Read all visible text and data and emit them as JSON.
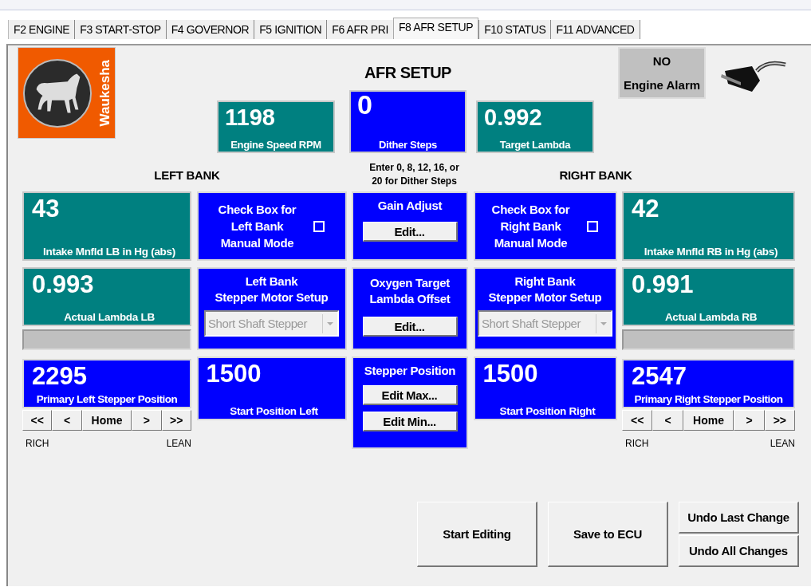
{
  "tabs": [
    {
      "label": "F2 ENGINE",
      "selected": false
    },
    {
      "label": "F3 START-STOP",
      "selected": false
    },
    {
      "label": "F4 GOVERNOR",
      "selected": false
    },
    {
      "label": "F5 IGNITION",
      "selected": false
    },
    {
      "label": "F6 AFR PRI",
      "selected": false
    },
    {
      "label": "F8 AFR SETUP",
      "selected": true
    },
    {
      "label": "F10 STATUS",
      "selected": false
    },
    {
      "label": "F11 ADVANCED",
      "selected": false
    }
  ],
  "logo": {
    "brand": "Waukesha"
  },
  "title": "AFR SETUP",
  "header_readouts": [
    {
      "value": "1198",
      "label": "Engine Speed RPM",
      "color": "#008080"
    },
    {
      "value": "0",
      "label": "Dither Steps",
      "color": "#0000ff"
    },
    {
      "value": "0.992",
      "label": "Target Lambda",
      "color": "#008080"
    }
  ],
  "engine_alarm": {
    "value": "NO",
    "label": "Engine Alarm"
  },
  "dither_hint": "Enter 0, 8, 12, 16, or\n20 for Dither Steps",
  "banks": [
    {
      "heading": "LEFT BANK",
      "intake": {
        "value": "43",
        "label": "Intake Mnfld LB in Hg (abs)"
      },
      "lambda": {
        "value": "0.993",
        "label": "Actual Lambda LB"
      },
      "manual_mode": {
        "label": "Check Box for\nLeft Bank\nManual Mode",
        "checked": false
      },
      "stepper_setup": {
        "title": "Left Bank\nStepper Motor Setup",
        "value": "Short Shaft Stepper",
        "disabled": true
      },
      "start_position": {
        "value": "1500",
        "label": "Start Position Left"
      },
      "primary_position": {
        "value": "2295",
        "label": "Primary Left Stepper Position"
      },
      "nav_buttons": [
        "<<",
        "<",
        "Home",
        ">",
        ">>"
      ],
      "rich": "RICH",
      "lean": "LEAN"
    },
    {
      "heading": "RIGHT BANK",
      "intake": {
        "value": "42",
        "label": "Intake Mnfld RB in Hg (abs)"
      },
      "lambda": {
        "value": "0.991",
        "label": "Actual Lambda RB"
      },
      "manual_mode": {
        "label": "Check Box for\nRight Bank\nManual Mode",
        "checked": false
      },
      "stepper_setup": {
        "title": "Right Bank\nStepper Motor Setup",
        "value": "Short Shaft Stepper",
        "disabled": true
      },
      "start_position": {
        "value": "1500",
        "label": "Start Position Right"
      },
      "primary_position": {
        "value": "2547",
        "label": "Primary Right Stepper Position"
      },
      "nav_buttons": [
        "<<",
        "<",
        "Home",
        ">",
        ">>"
      ],
      "rich": "RICH",
      "lean": "LEAN"
    }
  ],
  "center": {
    "gain_adjust": {
      "title": "Gain Adjust",
      "button": "Edit..."
    },
    "oxygen_offset": {
      "title": "Oxygen Target\nLambda Offset",
      "button": "Edit..."
    },
    "stepper_position": {
      "title": "Stepper Position",
      "buttons": [
        "Edit Max...",
        "Edit Min..."
      ]
    }
  },
  "actions": [
    "Start Editing",
    "Save to ECU"
  ],
  "undo_buttons": [
    "Undo Last Change",
    "Undo All Changes"
  ]
}
